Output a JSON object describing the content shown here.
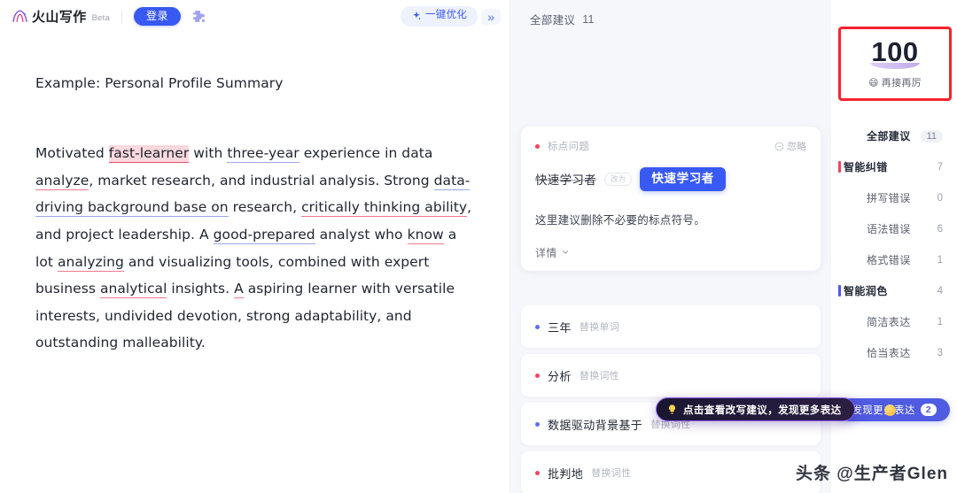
{
  "header": {
    "logo_text": "火山写作",
    "beta_tag": "Beta",
    "login_label": "登录",
    "puzzle_icon": "puzzle-icon",
    "optimize_label": "一键优化",
    "sparkle_icon": "sparkle-icon",
    "collapse_label": "»"
  },
  "document": {
    "title": "Example: Personal Profile Summary",
    "paragraph_parts": [
      "Motivated ",
      "fast-learner",
      " with ",
      "three-year",
      " experience in data ",
      "analyze",
      ", market research, and industrial analysis. Strong ",
      "data-driving background base on",
      " research, ",
      "critically thinking ability",
      ", and project leadership. A ",
      "good-prepared",
      " analyst who ",
      "know",
      " a lot ",
      "analyzing",
      " and visualizing tools, combined with expert business ",
      "analytical",
      " insights. ",
      "A",
      " aspiring learner with versatile interests, undivided devotion, strong adaptability, and outstanding malleability."
    ]
  },
  "suggestions": {
    "head_label": "全部建议",
    "head_count": "11",
    "card": {
      "tag": "标点问题",
      "ignore_label": "忽略",
      "ignore_icon": "circle-minus-icon",
      "original": "快速学习者",
      "arrow_chip": "改为",
      "replacement": "快速学习者",
      "description": "这里建议删除不必要的标点符号。",
      "more_label": "详情",
      "chevron_icon": "chevron-down-icon"
    },
    "items": [
      {
        "text": "三年",
        "kind": "替换单词",
        "dot": "blue"
      },
      {
        "text": "分析",
        "kind": "替换词性",
        "dot": "red"
      },
      {
        "text": "数据驱动背景基于",
        "kind": "替换词性",
        "dot": "blue"
      },
      {
        "text": "批判地",
        "kind": "替换词性",
        "dot": "red"
      }
    ],
    "tooltip": {
      "icon": "lightbulb-icon",
      "text": "点击查看改写建议，发现更多表达"
    }
  },
  "nav": {
    "score": "100",
    "score_sub": "再接再厉",
    "score_emoji": "😄",
    "items": [
      {
        "label": "全部建议",
        "count": "11",
        "level": "top",
        "pill": true,
        "bar": ""
      },
      {
        "label": "智能纠错",
        "count": "7",
        "level": "group",
        "pill": false,
        "bar": "#f0465e"
      },
      {
        "label": "拼写错误",
        "count": "0",
        "level": "sub",
        "pill": false,
        "bar": ""
      },
      {
        "label": "语法错误",
        "count": "6",
        "level": "sub",
        "pill": false,
        "bar": ""
      },
      {
        "label": "格式错误",
        "count": "1",
        "level": "sub",
        "pill": false,
        "bar": ""
      },
      {
        "label": "智能润色",
        "count": "4",
        "level": "group",
        "pill": false,
        "bar": "#4f5be0"
      },
      {
        "label": "简洁表达",
        "count": "1",
        "level": "sub",
        "pill": false,
        "bar": ""
      },
      {
        "label": "恰当表达",
        "count": "3",
        "level": "sub",
        "pill": false,
        "bar": ""
      }
    ],
    "discover_label": "发现更多表达",
    "discover_badge": "2"
  },
  "watermark": "头条 @生产者Glen",
  "colors": {
    "accent_blue": "#3959f3",
    "error_red": "#f0465e",
    "polish_blue": "#4f5be0",
    "annotation_red": "#f5222d"
  }
}
